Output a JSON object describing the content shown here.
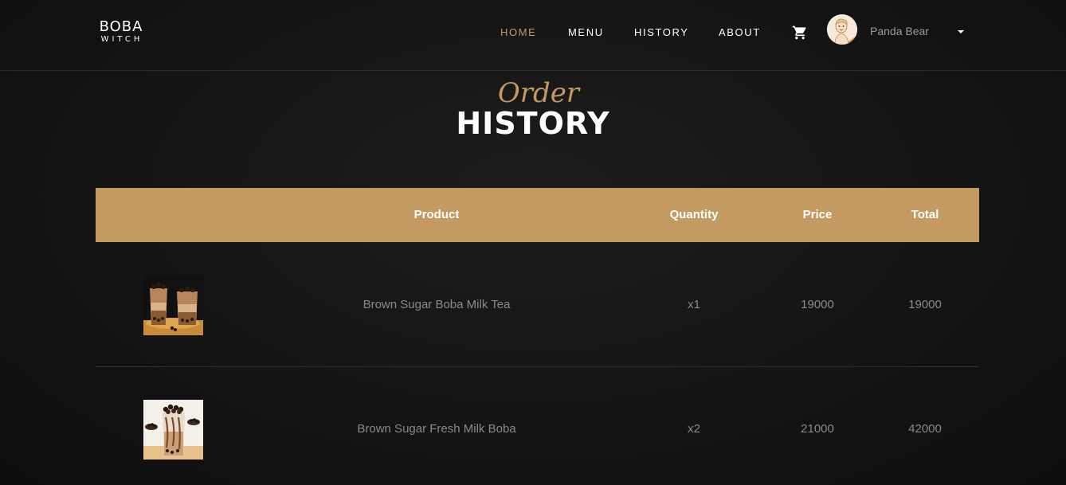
{
  "brand": {
    "name": "BOBA",
    "tagline": "WITCH"
  },
  "nav": {
    "items": [
      {
        "label": "HOME",
        "active": true
      },
      {
        "label": "MENU",
        "active": false
      },
      {
        "label": "HISTORY",
        "active": false
      },
      {
        "label": "ABOUT",
        "active": false
      }
    ],
    "cart_icon": "shopping-cart-icon"
  },
  "user": {
    "name": "Panda Bear",
    "avatar_icon": "user-avatar"
  },
  "page": {
    "title_script": "Order",
    "title_main": "HISTORY"
  },
  "table": {
    "headers": {
      "product": "Product",
      "quantity": "Quantity",
      "price": "Price",
      "total": "Total"
    },
    "rows": [
      {
        "product": "Brown Sugar Boba Milk Tea",
        "quantity": "x1",
        "price": "19000",
        "total": "19000",
        "image_icon": "boba-milk-tea-image"
      },
      {
        "product": "Brown Sugar Fresh Milk Boba",
        "quantity": "x2",
        "price": "21000",
        "total": "42000",
        "image_icon": "fresh-milk-boba-image"
      }
    ]
  },
  "colors": {
    "accent": "#c49a63",
    "background": "#141414",
    "muted_text": "#8a8a8a",
    "text": "#ffffff"
  }
}
